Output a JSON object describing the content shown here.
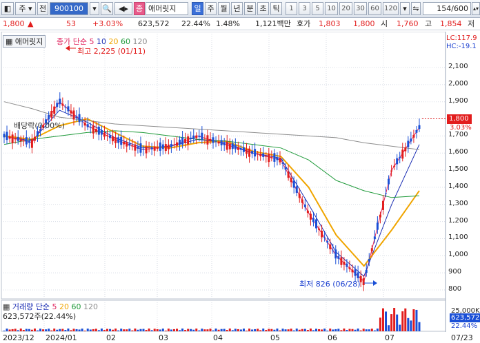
{
  "toolbar": {
    "market": "주",
    "period_prefix": "전",
    "code": "900100",
    "chart_type": "종",
    "stock_name": "애머릿지",
    "periods": [
      "일",
      "주",
      "월",
      "년",
      "분",
      "초",
      "틱"
    ],
    "active_period": "일",
    "intervals": [
      "1",
      "3",
      "5",
      "10",
      "20",
      "30",
      "60",
      "120"
    ],
    "page": "154/600"
  },
  "pricebar": {
    "price": "1,800",
    "change": "53",
    "change_pct": "+3.03%",
    "volume": "623,572",
    "turnover": "22.44%",
    "ratio": "1.48%",
    "amount": "1,121백만",
    "quote_label": "호가",
    "ask": "1,803",
    "bid": "1,800",
    "open_label": "시",
    "open": "1,760",
    "high_label": "고",
    "high": "1,854",
    "low_label": "저"
  },
  "chart": {
    "stock_tab": "애머릿지",
    "ma_legend_title": "종가 단순",
    "ma_periods": [
      "5",
      "10",
      "20",
      "60",
      "120"
    ],
    "ma_colors": [
      "#e0245e",
      "#1a2db3",
      "#f0a500",
      "#1f9a3a",
      "#8c8c8c"
    ],
    "lc": "LC:117.9",
    "hc": "HC:-19.1",
    "price_ticks": [
      "2,100",
      "2,000",
      "1,900",
      "1,800",
      "1,700",
      "1,600",
      "1,500",
      "1,400",
      "1,300",
      "1,200",
      "1,100",
      "1,000",
      "900",
      "800"
    ],
    "current_price": "1,800",
    "current_pct": "3.03%",
    "high_annotation": "최고 2,225 (01/11)",
    "low_annotation": "최저 826 (06/28)",
    "dividend_label": "배당락(0.00%)",
    "volume_title": "거래량 단순",
    "vol_ma_periods": [
      "5",
      "20",
      "60",
      "120"
    ],
    "volume_value": "623,572주(22.44%)",
    "volume_ticks": [
      "25,000K",
      "0.0K"
    ],
    "current_volume": "623,572",
    "current_vol_pct": "22.44%",
    "date_labels": [
      "2023/12",
      "2024/01",
      "02",
      "03",
      "04",
      "05",
      "06",
      "07",
      "07/23"
    ],
    "colors": {
      "up": "#e21d1d",
      "down": "#1a4fd6",
      "grid": "#d8dde6"
    }
  },
  "chart_data": {
    "type": "candlestick",
    "title": "",
    "x": [
      "2023/12",
      "2024/01",
      "02",
      "03",
      "04",
      "05",
      "06",
      "07",
      "07/23"
    ],
    "price_range": [
      760,
      2200
    ],
    "high": {
      "value": 2225,
      "date": "01/11"
    },
    "low": {
      "value": 826,
      "date": "06/28"
    },
    "last_close": 1800,
    "series": [
      {
        "name": "5",
        "values": [
          1700,
          1660,
          1900,
          1760,
          1680,
          1620,
          1640,
          1700,
          1650,
          1600,
          1560,
          1250,
          1000,
          850,
          1500,
          1750
        ]
      },
      {
        "name": "10",
        "values": [
          1700,
          1670,
          1850,
          1780,
          1690,
          1630,
          1640,
          1680,
          1660,
          1600,
          1570,
          1300,
          1020,
          880,
          1300,
          1650
        ]
      },
      {
        "name": "20",
        "values": [
          1700,
          1680,
          1760,
          1800,
          1720,
          1640,
          1630,
          1660,
          1670,
          1610,
          1580,
          1400,
          1120,
          940,
          1150,
          1380
        ]
      },
      {
        "name": "60",
        "values": [
          1650,
          1680,
          1700,
          1720,
          1730,
          1720,
          1700,
          1680,
          1670,
          1650,
          1630,
          1560,
          1440,
          1380,
          1340,
          1350
        ]
      },
      {
        "name": "120",
        "values": [
          1900,
          1860,
          1810,
          1790,
          1770,
          1760,
          1750,
          1740,
          1730,
          1720,
          1710,
          1700,
          1690,
          1660,
          1640,
          1620
        ]
      }
    ]
  }
}
